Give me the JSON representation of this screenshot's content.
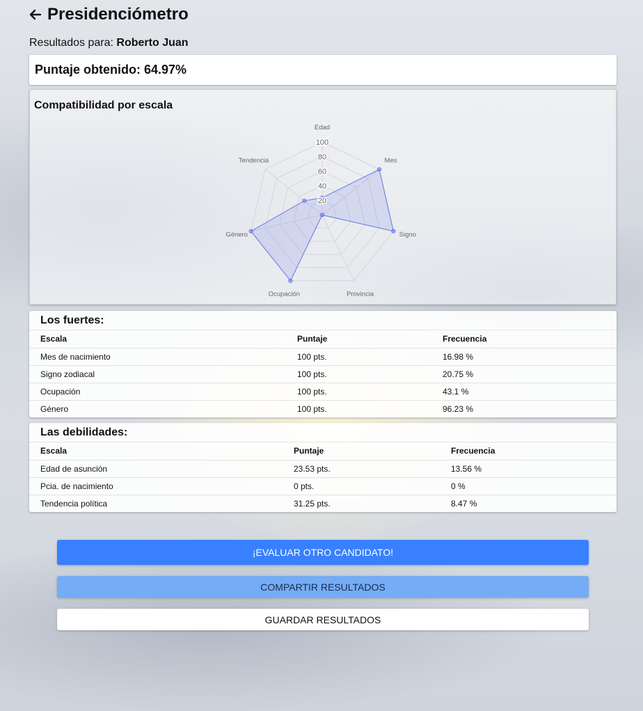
{
  "header": {
    "title": "Presidenciómetro"
  },
  "results": {
    "label": "Resultados para:",
    "name": "Roberto Juan"
  },
  "score": {
    "text": "Puntaje obtenido: 64.97%"
  },
  "chart": {
    "title": "Compatibilidad por escala"
  },
  "chart_data": {
    "type": "radar",
    "title": "Compatibilidad por escala",
    "axes": [
      "Edad",
      "Mes",
      "Signo",
      "Provincia",
      "Ocupación",
      "Género",
      "Tendencia"
    ],
    "ticks": [
      20,
      40,
      60,
      80,
      100
    ],
    "range": [
      0,
      100
    ],
    "series": [
      {
        "values": [
          23.53,
          100,
          100,
          0,
          100,
          100,
          31.25
        ],
        "color": "#6a78e8"
      }
    ],
    "grid": true
  },
  "fuertes": {
    "title": "Los fuertes:",
    "headers": [
      "Escala",
      "Puntaje",
      "Frecuencia"
    ],
    "rows": [
      [
        "Mes de nacimiento",
        "100 pts.",
        "16.98 %"
      ],
      [
        "Signo zodiacal",
        "100 pts.",
        "20.75 %"
      ],
      [
        "Ocupación",
        "100 pts.",
        "43.1 %"
      ],
      [
        "Género",
        "100 pts.",
        "96.23 %"
      ]
    ]
  },
  "debilidades": {
    "title": "Las debilidades:",
    "headers": [
      "Escala",
      "Puntaje",
      "Frecuencia"
    ],
    "rows": [
      [
        "Edad de asunción",
        "23.53 pts.",
        "13.56 %"
      ],
      [
        "Pcia. de nacimiento",
        "0 pts.",
        "0 %"
      ],
      [
        "Tendencia política",
        "31.25 pts.",
        "8.47 %"
      ]
    ]
  },
  "buttons": {
    "evaluate": "¡EVALUAR OTRO CANDIDATO!",
    "share": "COMPARTIR RESULTADOS",
    "save": "GUARDAR RESULTADOS"
  },
  "colors": {
    "primary": "#3880ff",
    "secondary": "#74acf5",
    "radar": "#6a78e8"
  },
  "icons": {
    "back": "arrow-left-icon"
  }
}
